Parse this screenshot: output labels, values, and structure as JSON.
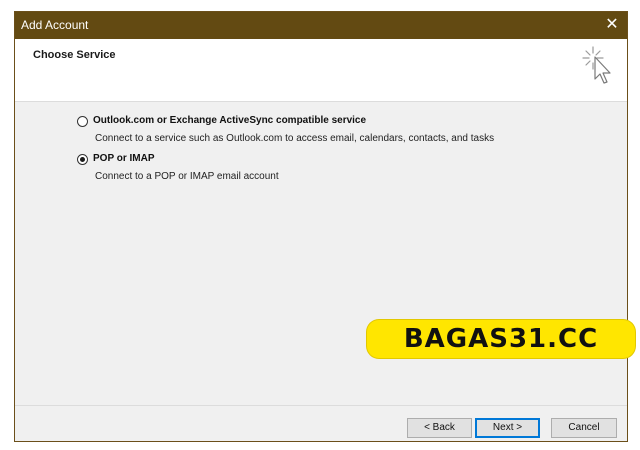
{
  "window": {
    "title": "Add Account",
    "close_glyph": "✕"
  },
  "header": {
    "title": "Choose Service",
    "icon": "magic-wand-cursor-icon"
  },
  "options": [
    {
      "label": "Outlook.com or Exchange ActiveSync compatible service",
      "description": "Connect to a service such as Outlook.com to access email, calendars, contacts, and tasks",
      "selected": false
    },
    {
      "label": "POP or IMAP",
      "description": "Connect to a POP or IMAP email account",
      "selected": true
    }
  ],
  "buttons": {
    "back": "< Back",
    "next": "Next >",
    "cancel": "Cancel"
  },
  "watermark": {
    "text": "BAGAS31.CC",
    "color": "#ffe600"
  },
  "colors": {
    "titlebar": "#634a12",
    "dialog_bg": "#f0f0f0",
    "focus": "#0078d7"
  }
}
